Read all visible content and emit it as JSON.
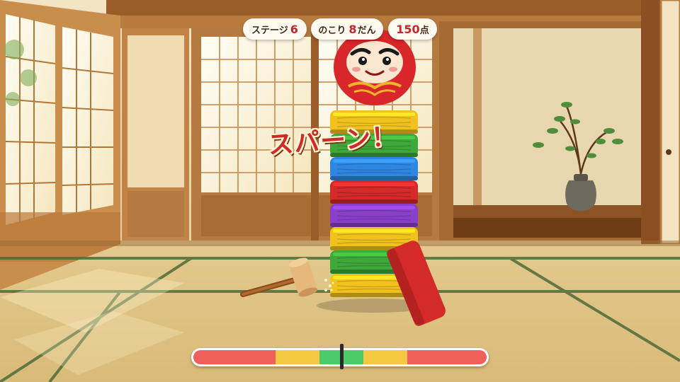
{
  "hud": {
    "stage_label": "ステージ",
    "stage_value": "6",
    "remaining_prefix": "のこり",
    "remaining_value": "8",
    "remaining_suffix": "だん",
    "score_value": "150",
    "score_suffix": "点"
  },
  "callout": "スパーン！",
  "tower_blocks": [
    {
      "color": "yellow",
      "hex": "#f1c21e"
    },
    {
      "color": "green",
      "hex": "#3fa83a"
    },
    {
      "color": "blue",
      "hex": "#2f86e0"
    },
    {
      "color": "red",
      "hex": "#d42a2a"
    },
    {
      "color": "purple",
      "hex": "#8a3fc9"
    },
    {
      "color": "yellow",
      "hex": "#f1c21e"
    },
    {
      "color": "green",
      "hex": "#3fa83a"
    },
    {
      "color": "yellow",
      "hex": "#f1c21e"
    }
  ],
  "flying_block": {
    "color": "red",
    "hex": "#d42a2a"
  },
  "timing_meter": {
    "zones": [
      {
        "name": "miss",
        "hex": "#f0605a",
        "fraction": 0.28
      },
      {
        "name": "ok",
        "hex": "#f6c943",
        "fraction": 0.15
      },
      {
        "name": "perfect",
        "hex": "#4ccb6a",
        "fraction": 0.15
      },
      {
        "name": "ok",
        "hex": "#f6c943",
        "fraction": 0.15
      },
      {
        "name": "miss",
        "hex": "#f0605a",
        "fraction": 0.27
      }
    ],
    "needle_position": 0.505
  },
  "icons": {
    "daruma": "daruma-icon",
    "hammer": "hammer-icon",
    "vase": "vase-icon"
  }
}
